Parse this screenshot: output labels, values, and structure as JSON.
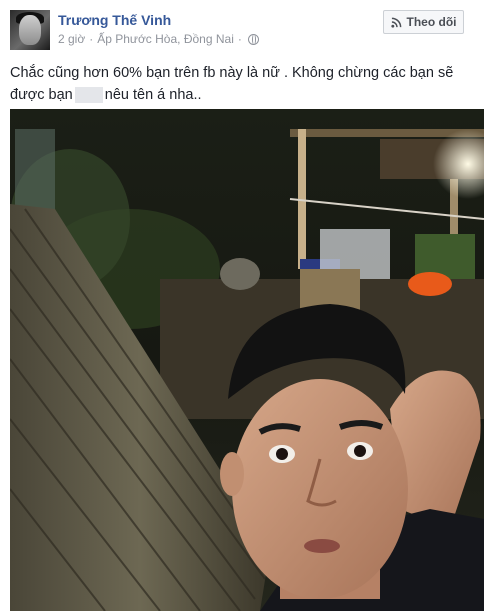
{
  "post": {
    "author_name": "Trương Thế Vinh",
    "time": "2 giờ",
    "separator": "·",
    "location": "Ấp Phước Hòa, Đồng Nai",
    "privacy_icon": "globe-icon",
    "follow_icon": "rss-icon",
    "follow_label": "Theo dõi",
    "text_part1": "Chắc cũng hơn 60% bạn trên fb này là nữ . Không chừng các bạn sẽ được bạn",
    "text_part2": "nêu tên á nha.."
  },
  "colors": {
    "author_link": "#365899",
    "meta_text": "#90949c",
    "body_text": "#1d2129",
    "button_bg": "#f6f7f9",
    "button_border": "#ccd0d5"
  }
}
